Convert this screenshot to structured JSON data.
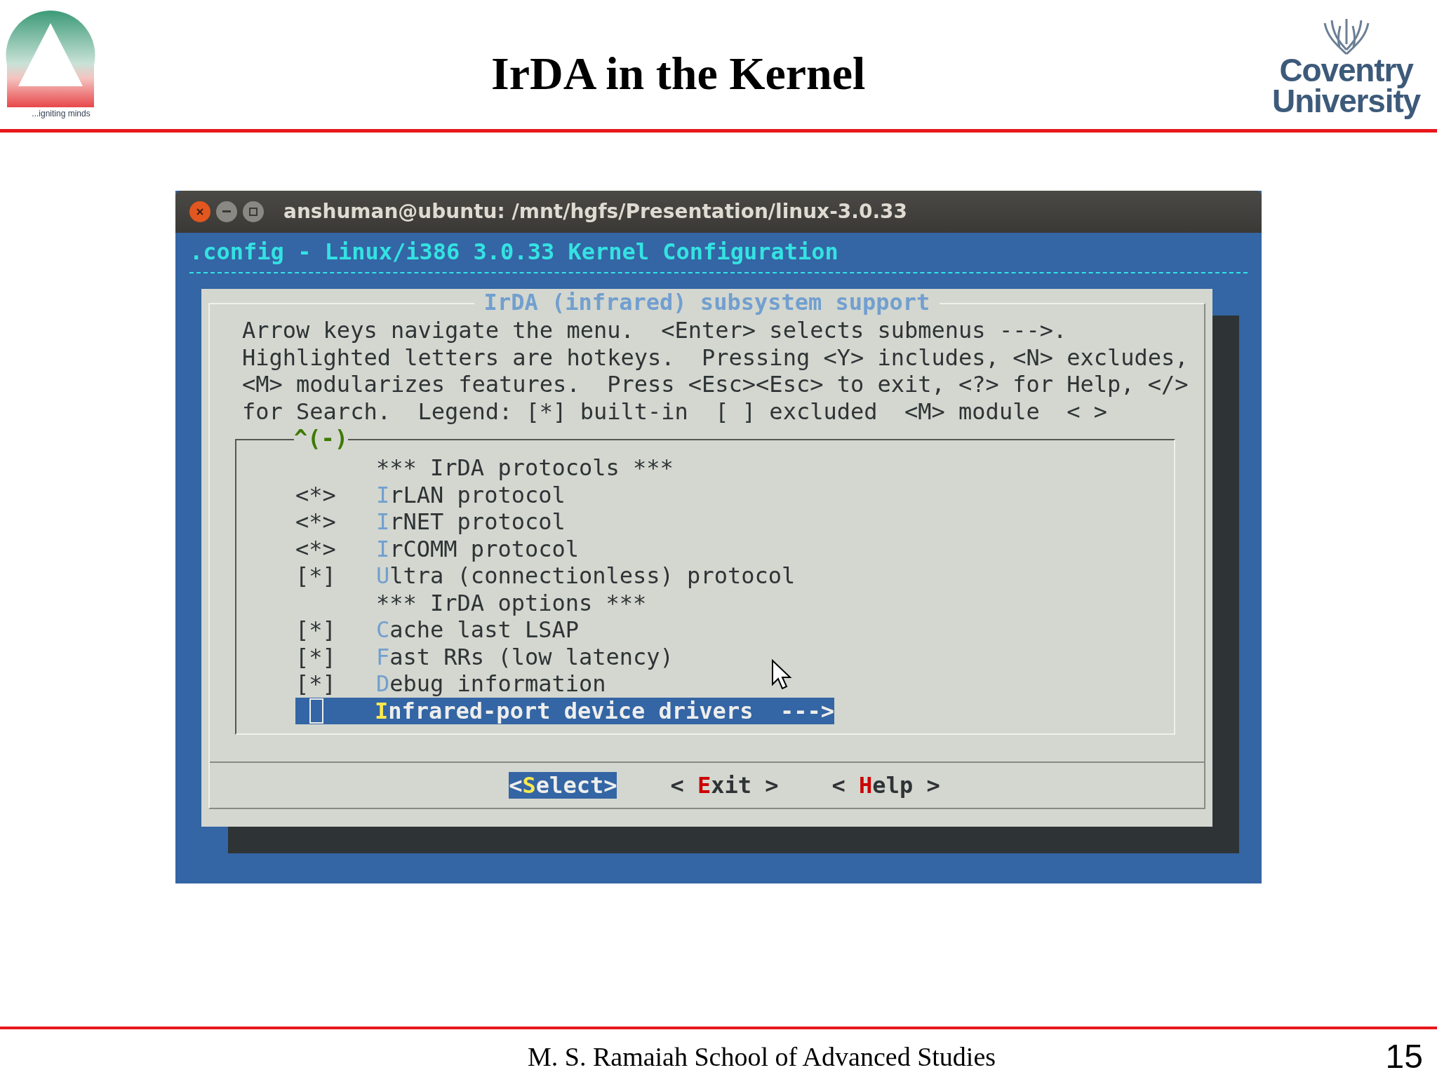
{
  "slide": {
    "title": "IrDA in the Kernel",
    "logo_left_tagline": "...igniting minds",
    "logo_right_lines": [
      "Coventry",
      "University"
    ],
    "footer": "M. S. Ramaiah School of Advanced Studies",
    "page_number": "15"
  },
  "window": {
    "title": "anshuman@ubuntu: /mnt/hgfs/Presentation/linux-3.0.33"
  },
  "terminal": {
    "header": ".config - Linux/i386 3.0.33 Kernel Configuration",
    "dialog": {
      "title": "IrDA (infrared) subsystem support",
      "help": [
        "Arrow keys navigate the menu.  <Enter> selects submenus --->.",
        "Highlighted letters are hotkeys.  Pressing <Y> includes, <N> excludes,",
        "<M> modularizes features.  Press <Esc><Esc> to exit, <?> for Help, </>",
        "for Search.  Legend: [*] built-in  [ ] excluded  <M> module  < >"
      ],
      "scroll_indicator": "^(-)",
      "items": [
        {
          "kind": "comment",
          "label": "*** IrDA protocols ***",
          "selected": false
        },
        {
          "kind": "option",
          "marker": "<*>",
          "hotkey": "I",
          "label": "rLAN protocol",
          "selected": false
        },
        {
          "kind": "option",
          "marker": "<*>",
          "hotkey": "I",
          "label": "rNET protocol",
          "selected": false
        },
        {
          "kind": "option",
          "marker": "<*>",
          "hotkey": "I",
          "label": "rCOMM protocol",
          "selected": false
        },
        {
          "kind": "option",
          "marker": "[*]",
          "hotkey": "U",
          "label": "ltra (connectionless) protocol",
          "selected": false
        },
        {
          "kind": "comment",
          "label": "*** IrDA options ***",
          "selected": false
        },
        {
          "kind": "option",
          "marker": "[*]",
          "hotkey": "C",
          "label": "ache last LSAP",
          "selected": false
        },
        {
          "kind": "option",
          "marker": "[*]",
          "hotkey": "F",
          "label": "ast RRs (low latency)",
          "selected": false
        },
        {
          "kind": "option",
          "marker": "[*]",
          "hotkey": "D",
          "label": "ebug information",
          "selected": false
        },
        {
          "kind": "menu",
          "hotkey": "I",
          "label": "nfrared-port device drivers  --->",
          "selected": true
        }
      ],
      "buttons": [
        {
          "before": "<",
          "hotkey": "S",
          "after": "elect>",
          "selected": true
        },
        {
          "before": "< ",
          "hotkey": "E",
          "after": "xit >",
          "selected": false
        },
        {
          "before": "< ",
          "hotkey": "H",
          "after": "elp >",
          "selected": false
        }
      ]
    }
  }
}
